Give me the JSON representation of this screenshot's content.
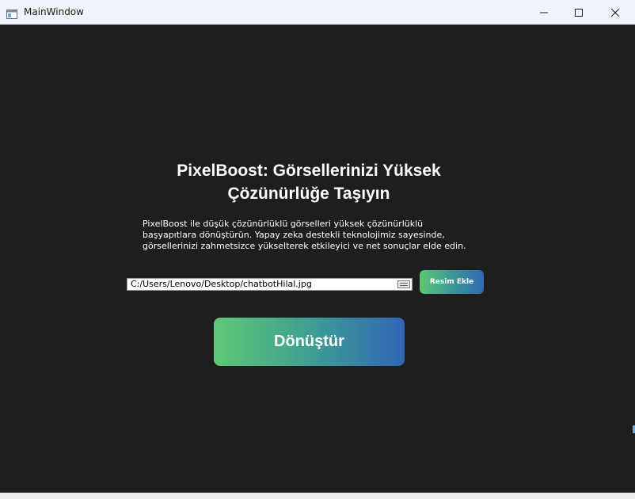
{
  "window": {
    "title": "MainWindow",
    "controls": [
      "minimize-icon",
      "maximize-icon",
      "close-icon"
    ]
  },
  "main": {
    "heading": "PixelBoost: Görsellerinizi Yüksek Çözünürlüğe Taşıyın",
    "description": "PixelBoost ile düşük çözünürlüklü görselleri yüksek çözünürlüklü başyapıtlara dönüştürün. Yapay zeka destekli teknolojimiz sayesinde, görsellerinizi zahmetsizce yükselterek etkileyici ve net sonuçlar elde edin.",
    "file_path": "C:/Users/Lenovo/Desktop/chatbotHilal.jpg",
    "add_image_label": "Resim Ekle",
    "convert_label": "Dönüştür"
  },
  "colors": {
    "background": "#1c1e20",
    "gradient_start": "#5fc673",
    "gradient_end": "#3169b4",
    "titlebar": "#f0f3f9",
    "text": "#ffffff"
  }
}
